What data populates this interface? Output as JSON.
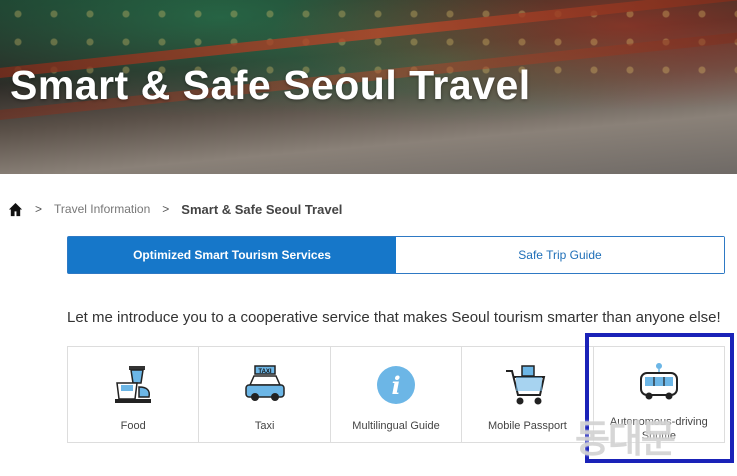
{
  "hero": {
    "title": "Smart & Safe Seoul Travel"
  },
  "breadcrumb": {
    "home_icon": "home-icon",
    "separator": ">",
    "items": [
      "Travel Information",
      "Smart & Safe Seoul Travel"
    ]
  },
  "tabs": [
    {
      "label": "Optimized Smart Tourism Services",
      "active": true
    },
    {
      "label": "Safe Trip Guide",
      "active": false
    }
  ],
  "intro_text": "Let me introduce you to a cooperative service that makes Seoul tourism smarter than anyone else!",
  "services": [
    {
      "label": "Food",
      "icon": "food-icon"
    },
    {
      "label": "Taxi",
      "icon": "taxi-icon"
    },
    {
      "label": "Multilingual Guide",
      "icon": "info-icon"
    },
    {
      "label": "Mobile Passport",
      "icon": "shopping-cart-icon"
    },
    {
      "label": "Autonomous-driving Shuttle",
      "icon": "shuttle-bus-icon"
    }
  ],
  "taxi_sign": "TAXI",
  "info_glyph": "i",
  "watermark": "동대문",
  "colors": {
    "accent": "#1677c9",
    "highlight_box": "#1a22b8",
    "info_circle": "#6cb6e6"
  }
}
